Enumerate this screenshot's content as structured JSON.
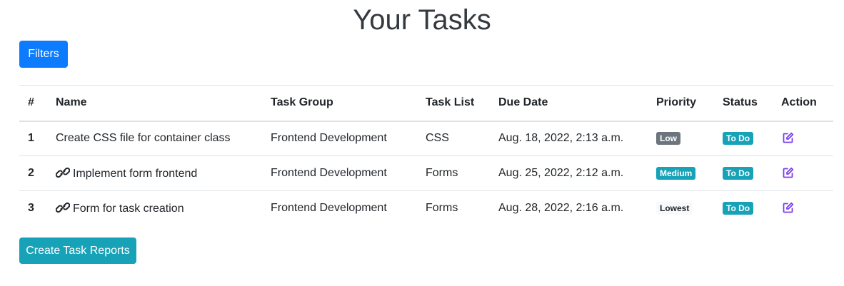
{
  "page": {
    "title": "Your Tasks"
  },
  "toolbar": {
    "filters_label": "Filters"
  },
  "table": {
    "headers": [
      "#",
      "Name",
      "Task Group",
      "Task List",
      "Due Date",
      "Priority",
      "Status",
      "Action"
    ],
    "rows": [
      {
        "num": "1",
        "name": "Create CSS file for container class",
        "has_link": false,
        "group": "Frontend Development",
        "list": "CSS",
        "due": "Aug. 18, 2022, 2:13 a.m.",
        "priority": "Low",
        "status": "To Do"
      },
      {
        "num": "2",
        "name": "Implement form frontend",
        "has_link": true,
        "group": "Frontend Development",
        "list": "Forms",
        "due": "Aug. 25, 2022, 2:12 a.m.",
        "priority": "Medium",
        "status": "To Do"
      },
      {
        "num": "3",
        "name": "Form for task creation",
        "has_link": true,
        "group": "Frontend Development",
        "list": "Forms",
        "due": "Aug. 28, 2022, 2:16 a.m.",
        "priority": "Lowest",
        "status": "To Do"
      }
    ]
  },
  "footer": {
    "create_report_label": "Create Task Reports"
  },
  "icons": {
    "link": "link-icon",
    "edit": "edit-icon"
  },
  "colors": {
    "primary": "#0d7bfd",
    "info": "#17a2b8",
    "secondary": "#6c757d",
    "light": "#f8f9fa",
    "edit_icon": "#7a3ff0"
  }
}
